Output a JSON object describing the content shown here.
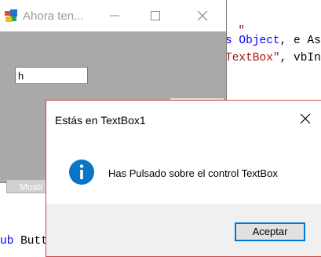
{
  "code": {
    "line1_frag": "\"",
    "line2_kw": "s Object",
    "line2_rest": ", e As",
    "line3_str": "TextBox\"",
    "line3_rest": ", vbIn",
    "line4_kw": "ub",
    "line4_rest": " Butt"
  },
  "form": {
    "title": "Ahora ten...",
    "textbox_value": "h",
    "mostrar_label": "Mostr"
  },
  "msgbox": {
    "title": "Estás en TextBox1",
    "message": "Has Pulsado sobre el control TextBox",
    "ok_label": "Aceptar"
  },
  "icons": {
    "app": "app-icon",
    "minimize": "minimize-icon",
    "maximize": "maximize-icon",
    "close": "close-icon",
    "info": "information-icon"
  },
  "colors": {
    "form_background": "#a9a9a9",
    "info_icon": "#0a74c6",
    "button_focus": "#0078d7"
  }
}
